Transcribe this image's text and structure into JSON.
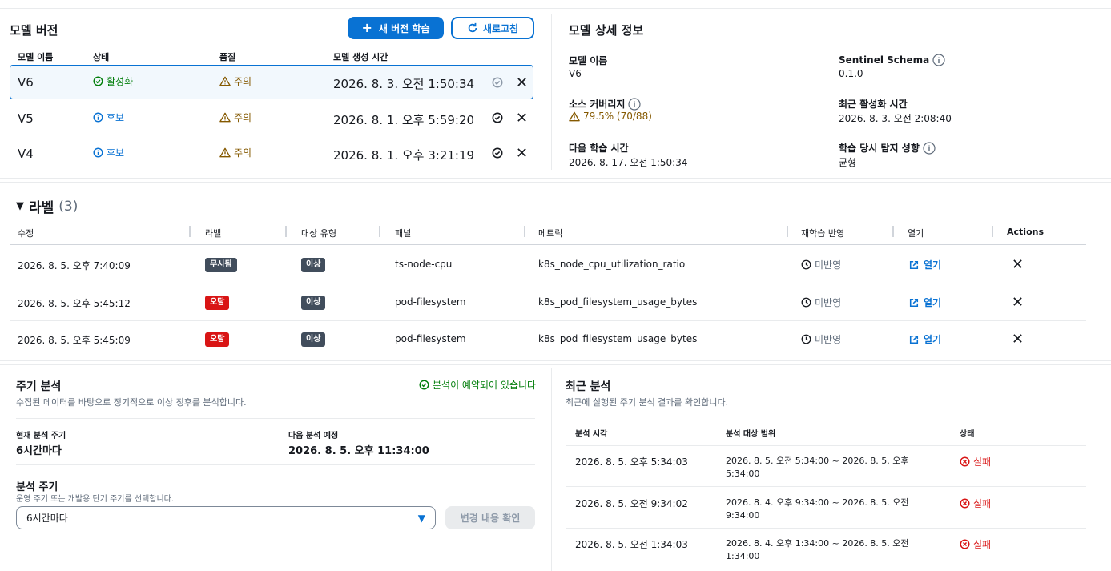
{
  "model_versions": {
    "title": "모델 버전",
    "new_button": "새 버전 학습",
    "refresh_button": "새로고침",
    "columns": [
      "모델 이름",
      "상태",
      "품질",
      "모델 생성 시간"
    ],
    "rows": [
      {
        "name": "V6",
        "status": "활성화",
        "quality": "주의",
        "created": "2026. 8. 3. 오전 1:50:34"
      },
      {
        "name": "V5",
        "status": "후보",
        "quality": "주의",
        "created": "2026. 8. 1. 오후 5:59:20"
      },
      {
        "name": "V4",
        "status": "후보",
        "quality": "주의",
        "created": "2026. 8. 1. 오후 3:21:19"
      }
    ]
  },
  "model_detail": {
    "title": "모델 상세 정보",
    "name_label": "모델 이름",
    "name_value": "V6",
    "schema_label": "Sentinel Schema",
    "schema_value": "0.1.0",
    "coverage_label": "소스 커버리지",
    "coverage_value": "79.5% (70/88)",
    "last_active_label": "최근 활성화 시간",
    "last_active_value": "2026. 8. 3. 오전 2:08:40",
    "next_train_label": "다음 학습 시간",
    "next_train_value": "2026. 8. 17. 오전 1:50:34",
    "tendency_label": "학습 당시 탐지 성향",
    "tendency_value": "균형"
  },
  "labels": {
    "title": "라벨",
    "count": "(3)",
    "columns": [
      "수정",
      "라벨",
      "대상 유형",
      "패널",
      "메트릭",
      "재학습 반영",
      "열기",
      "Actions"
    ],
    "rows": [
      {
        "modified": "2026. 8. 5. 오후 7:40:09",
        "label": "무시됨",
        "target": "이상",
        "panel": "ts-node-cpu",
        "metric": "k8s_node_cpu_utilization_ratio",
        "retrain": "미반영",
        "open": "열기"
      },
      {
        "modified": "2026. 8. 5. 오후 5:45:12",
        "label": "오탐",
        "target": "이상",
        "panel": "pod-filesystem",
        "metric": "k8s_pod_filesystem_usage_bytes",
        "retrain": "미반영",
        "open": "열기"
      },
      {
        "modified": "2026. 8. 5. 오후 5:45:09",
        "label": "오탐",
        "target": "이상",
        "panel": "pod-filesystem",
        "metric": "k8s_pod_filesystem_usage_bytes",
        "retrain": "미반영",
        "open": "열기"
      }
    ]
  },
  "periodic": {
    "title": "주기 분석",
    "desc": "수집된 데이터를 바탕으로 정기적으로 이상 징후를 분석합니다.",
    "scheduled": "분석이 예약되어 있습니다",
    "current_label": "현재 분석 주기",
    "current_value": "6시간마다",
    "next_label": "다음 분석 예정",
    "next_value": "2026. 8. 5. 오후 11:34:00",
    "period_label": "분석 주기",
    "period_desc": "운영 주기 또는 개발용 단기 주기를 선택합니다.",
    "select_value": "6시간마다",
    "confirm_button": "변경 내용 확인"
  },
  "recent": {
    "title": "최근 분석",
    "desc": "최근에 실행된 주기 분석 결과를 확인합니다.",
    "columns": [
      "분석 시각",
      "분석 대상 범위",
      "상태"
    ],
    "rows": [
      {
        "time": "2026. 8. 5. 오후 5:34:03",
        "range1": "2026. 8. 5. 오전 5:34:00 ~ 2026. 8. 5. 오후",
        "range2": "5:34:00",
        "status": "실패"
      },
      {
        "time": "2026. 8. 5. 오전 9:34:02",
        "range1": "2026. 8. 4. 오후 9:34:00 ~ 2026. 8. 5. 오전",
        "range2": "9:34:00",
        "status": "실패"
      },
      {
        "time": "2026. 8. 5. 오전 1:34:03",
        "range1": "2026. 8. 4. 오후 1:34:00 ~ 2026. 8. 5. 오전",
        "range2": "1:34:00",
        "status": "실패"
      }
    ]
  },
  "colors": {
    "primary": "#0972d3",
    "success": "#037f0c",
    "warning": "#855900",
    "error": "#d91515",
    "badge_dark": "#414d5c"
  }
}
